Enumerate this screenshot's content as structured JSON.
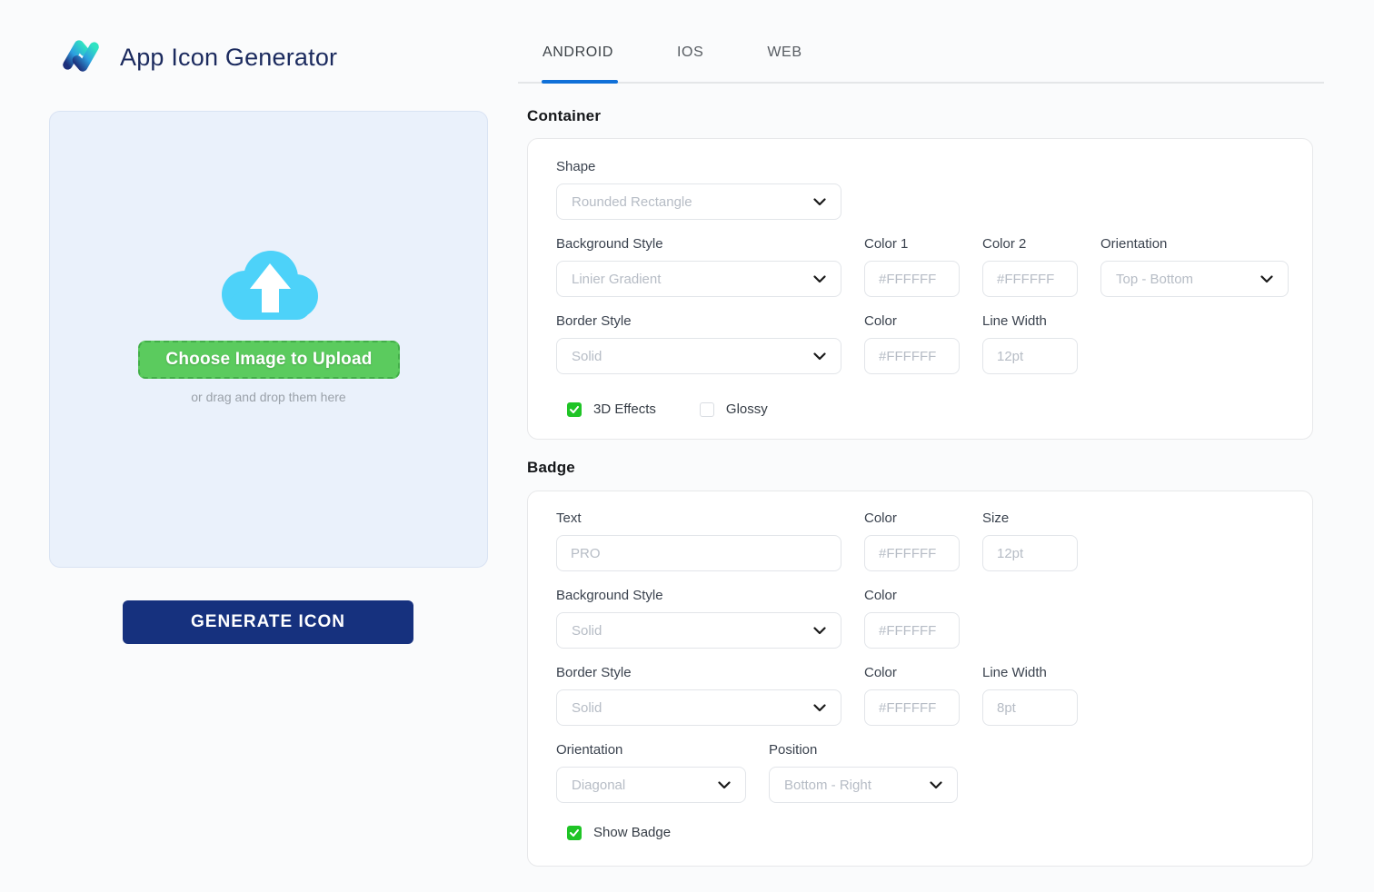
{
  "brand": {
    "title": "App Icon Generator"
  },
  "tabs": {
    "android": "ANDROID",
    "ios": "IOS",
    "web": "WEB",
    "active_tab": "ANDROID"
  },
  "uploader": {
    "button_label": "Choose Image to Upload",
    "hint": "or drag and drop them here"
  },
  "generate": {
    "label": "GENERATE ICON"
  },
  "container": {
    "title": "Container",
    "shape_label": "Shape",
    "shape_value": "Rounded Rectangle",
    "bg_style_label": "Background Style",
    "bg_style_value": "Linier Gradient",
    "color1_label": "Color 1",
    "color1_placeholder": "#FFFFFF",
    "color2_label": "Color 2",
    "color2_placeholder": "#FFFFFF",
    "orientation_label": "Orientation",
    "orientation_value": "Top - Bottom",
    "border_style_label": "Border Style",
    "border_style_value": "Solid",
    "border_color_label": "Color",
    "border_color_placeholder": "#FFFFFF",
    "line_width_label": "Line Width",
    "line_width_placeholder": "12pt",
    "effects3d_label": "3D Effects",
    "effects3d_checked": true,
    "glossy_label": "Glossy",
    "glossy_checked": false
  },
  "badge": {
    "title": "Badge",
    "text_label": "Text",
    "text_placeholder": "PRO",
    "text_color_label": "Color",
    "text_color_placeholder": "#FFFFFF",
    "size_label": "Size",
    "size_placeholder": "12pt",
    "bg_style_label": "Background Style",
    "bg_style_value": "Solid",
    "bg_color_label": "Color",
    "bg_color_placeholder": "#FFFFFF",
    "border_style_label": "Border Style",
    "border_style_value": "Solid",
    "border_color_label": "Color",
    "border_color_placeholder": "#FFFFFF",
    "line_width_label": "Line Width",
    "line_width_placeholder": "8pt",
    "orientation_label": "Orientation",
    "orientation_value": "Diagonal",
    "position_label": "Position",
    "position_value": "Bottom - Right",
    "show_badge_label": "Show Badge",
    "show_badge_checked": true
  },
  "colors": {
    "accent_blue": "#1070d8",
    "check_green": "#1fc426",
    "upload_button_green": "#5bcb5e",
    "generate_navy": "#16317e",
    "cloud_blue": "#4dd2f9",
    "title_navy": "#1b2a5e"
  }
}
